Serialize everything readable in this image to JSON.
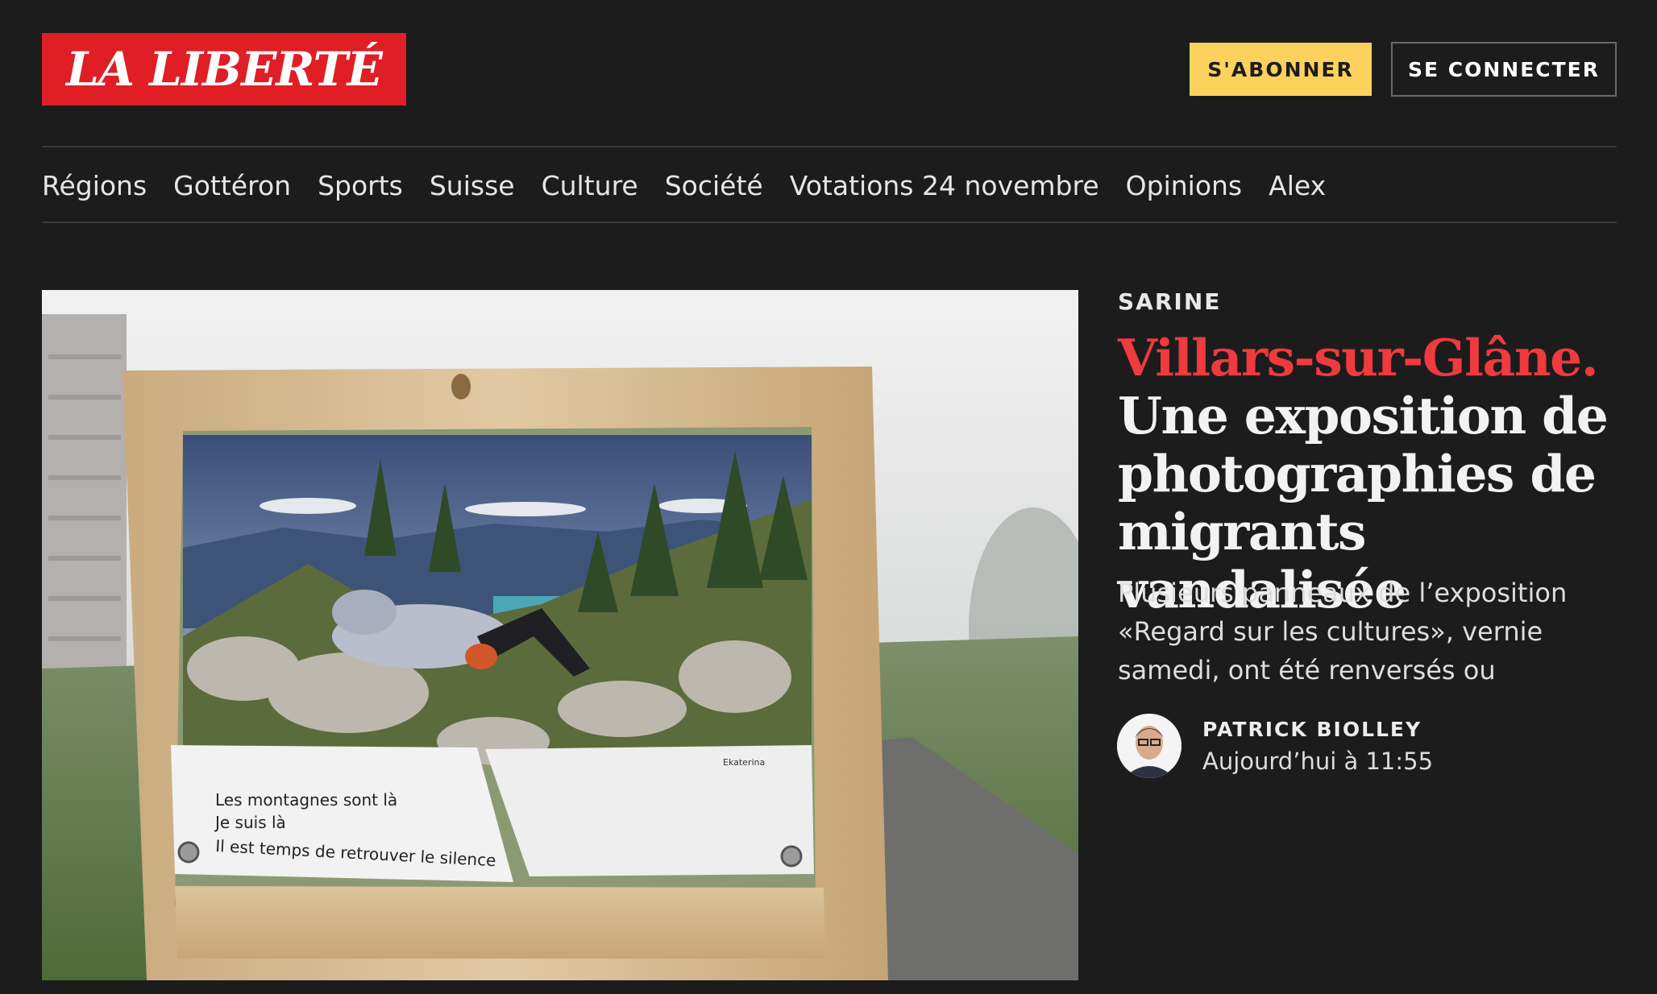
{
  "header": {
    "logo_text": "LA LIBERTÉ",
    "subscribe_label": "S'ABONNER",
    "login_label": "SE CONNECTER"
  },
  "nav": {
    "items": [
      "Régions",
      "Gottéron",
      "Sports",
      "Suisse",
      "Culture",
      "Société",
      "Votations 24 novembre",
      "Opinions",
      "Alex"
    ]
  },
  "article": {
    "kicker": "SARINE",
    "place": "Villars-sur-Glâne.",
    "title": "Une exposition de photographies de migrants vandalisée",
    "lead": "Plusieurs panneaux de l’exposition «Regard sur les cultures», vernie samedi, ont été renversés ou éventré…",
    "author": "PATRICK BIOLLEY",
    "date": "Aujourd’hui à 11:55",
    "image": {
      "poem_line_1": "Les montagnes sont là",
      "poem_line_2": "Je suis là",
      "poem_line_3": "Il est temps de retrouver le silence",
      "credit": "Ekaterina"
    }
  },
  "colors": {
    "background": "#1c1c1d",
    "brand_red": "#e01e25",
    "accent_red": "#ef3a3e",
    "subscribe_yellow": "#fcd25c"
  }
}
